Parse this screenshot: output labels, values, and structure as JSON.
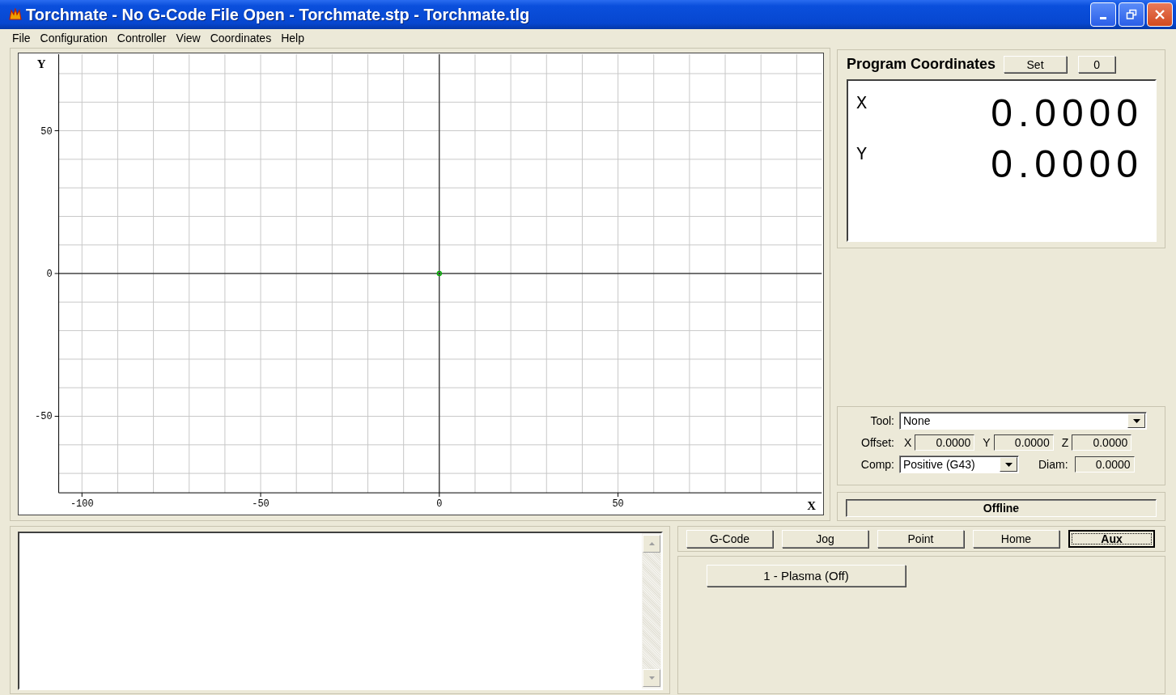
{
  "window": {
    "title": "Torchmate - No G-Code File Open - Torchmate.stp - Torchmate.tlg"
  },
  "menu": [
    "File",
    "Configuration",
    "Controller",
    "View",
    "Coordinates",
    "Help"
  ],
  "plot": {
    "chart_data": {
      "type": "scatter",
      "grid": true,
      "xlabel": "X",
      "ylabel": "Y",
      "xlim": [
        -106.5,
        107
      ],
      "ylim": [
        -76.8,
        76.8
      ],
      "xticks": [
        -100,
        -50,
        0,
        50
      ],
      "yticks": [
        -50,
        0,
        50
      ],
      "x": [
        0
      ],
      "series": [
        {
          "color": "#00b000",
          "values": [
            0
          ]
        }
      ]
    }
  },
  "coordinates": {
    "title": "Program Coordinates",
    "buttons": [
      "Set",
      "0"
    ],
    "axes": [
      {
        "label": "X",
        "value": "0.0000"
      },
      {
        "label": "Y",
        "value": "0.0000"
      }
    ]
  },
  "tool": {
    "tool_label": "Tool:",
    "tool_value": "None",
    "offset_label": "Offset:",
    "offsets": [
      {
        "axis": "X",
        "value": "0.0000"
      },
      {
        "axis": "Y",
        "value": "0.0000"
      },
      {
        "axis": "Z",
        "value": "0.0000"
      }
    ],
    "comp_label": "Comp:",
    "comp_value": "Positive (G43)",
    "diam_label": "Diam:",
    "diam_value": "0.0000"
  },
  "status": "Offline",
  "tabs": [
    {
      "label": "G-Code",
      "selected": false
    },
    {
      "label": "Jog",
      "selected": false
    },
    {
      "label": "Point",
      "selected": false
    },
    {
      "label": "Home",
      "selected": false
    },
    {
      "label": "Aux",
      "selected": true
    }
  ],
  "aux_buttons": [
    "1 - Plasma (Off)"
  ]
}
